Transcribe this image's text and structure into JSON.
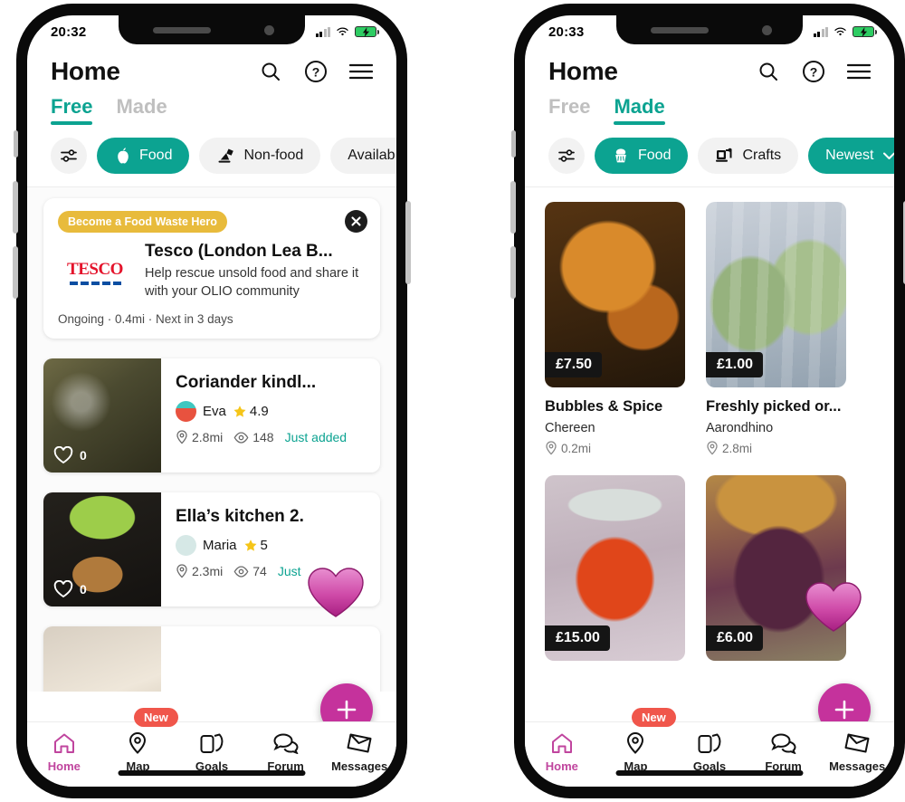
{
  "phones": [
    {
      "id": "left",
      "status": {
        "clock": "20:32",
        "signal_icon": "cellular-signal-icon",
        "wifi_icon": "wifi-icon",
        "battery_icon": "battery-charging-icon"
      },
      "header": {
        "title": "Home",
        "icons": [
          {
            "name": "search-icon",
            "label": "Search"
          },
          {
            "name": "help-icon",
            "label": "Help"
          },
          {
            "name": "menu-icon",
            "label": "Menu"
          }
        ]
      },
      "tabs": [
        {
          "label": "Free",
          "active": true
        },
        {
          "label": "Made",
          "active": false
        }
      ],
      "chips": [
        {
          "name": "filter-settings-chip",
          "label": "",
          "icon": "sliders-icon",
          "active": false,
          "round": true
        },
        {
          "name": "chip-food",
          "label": "Food",
          "icon": "apple-icon",
          "active": true
        },
        {
          "name": "chip-non-food",
          "label": "Non-food",
          "icon": "lamp-icon",
          "active": false
        },
        {
          "name": "chip-availability",
          "label": "Availab",
          "icon": "",
          "active": false
        }
      ],
      "promo": {
        "badge": "Become a Food Waste Hero",
        "brand": "TESCO",
        "title": "Tesco (London Lea B...",
        "description": "Help rescue unsold food and share it with your OLIO community",
        "meta": "Ongoing · 0.4mi · Next in 3 days",
        "close_icon": "close-icon"
      },
      "listings": [
        {
          "title": "Coriander kindl...",
          "user": "Eva",
          "rating": "4.9",
          "distance": "2.8mi",
          "views": "148",
          "status": "Just added",
          "fav_count": "0",
          "image_class": "img-coriander",
          "avatar_color": "#e8523f"
        },
        {
          "title": "Ella’s kitchen 2.",
          "user": "Maria",
          "rating": "5",
          "distance": "2.3mi",
          "views": "74",
          "status": "Just",
          "fav_count": "0",
          "image_class": "img-ella",
          "avatar_color": "#d6e8e6"
        }
      ],
      "nav": {
        "new_badge": "New",
        "items": [
          {
            "label": "Home",
            "icon": "home-icon",
            "active": true
          },
          {
            "label": "Map",
            "icon": "map-pin-icon",
            "active": false
          },
          {
            "label": "Goals",
            "icon": "cards-icon",
            "active": false
          },
          {
            "label": "Forum",
            "icon": "chat-bubbles-icon",
            "active": false
          },
          {
            "label": "Messages",
            "icon": "envelope-icon",
            "active": false
          }
        ]
      },
      "fab": {
        "name": "add-listing-fab",
        "icon": "plus-icon"
      },
      "cursor": {
        "name": "heart-cursor",
        "icon": "heart-icon"
      }
    },
    {
      "id": "right",
      "status": {
        "clock": "20:33",
        "signal_icon": "cellular-signal-icon",
        "wifi_icon": "wifi-icon",
        "battery_icon": "battery-charging-icon"
      },
      "header": {
        "title": "Home",
        "icons": [
          {
            "name": "search-icon",
            "label": "Search"
          },
          {
            "name": "help-icon",
            "label": "Help"
          },
          {
            "name": "menu-icon",
            "label": "Menu"
          }
        ]
      },
      "tabs": [
        {
          "label": "Free",
          "active": false
        },
        {
          "label": "Made",
          "active": true
        }
      ],
      "chips": [
        {
          "name": "filter-settings-chip",
          "label": "",
          "icon": "sliders-icon",
          "active": false,
          "round": true
        },
        {
          "name": "chip-food",
          "label": "Food",
          "icon": "cupcake-icon",
          "active": true
        },
        {
          "name": "chip-crafts",
          "label": "Crafts",
          "icon": "sewing-machine-icon",
          "active": false
        },
        {
          "name": "chip-sort-newest",
          "label": "Newest",
          "icon": "chevron-down-icon",
          "active": true,
          "dropdown": true
        }
      ],
      "grid": [
        {
          "title": "Bubbles & Spice",
          "user": "Chereen",
          "distance": "0.2mi",
          "price": "£7.50",
          "image_class": "img-chicken"
        },
        {
          "title": "Freshly picked or...",
          "user": "Aarondhino",
          "distance": "2.8mi",
          "price": "£1.00",
          "image_class": "img-greens"
        },
        {
          "title": "",
          "user": "",
          "distance": "",
          "price": "£15.00",
          "image_class": "img-kimchi"
        },
        {
          "title": "",
          "user": "",
          "distance": "",
          "price": "£6.00",
          "image_class": "img-seaweed"
        }
      ],
      "nav": {
        "new_badge": "New",
        "items": [
          {
            "label": "Home",
            "icon": "home-icon",
            "active": true
          },
          {
            "label": "Map",
            "icon": "map-pin-icon",
            "active": false
          },
          {
            "label": "Goals",
            "icon": "cards-icon",
            "active": false
          },
          {
            "label": "Forum",
            "icon": "chat-bubbles-icon",
            "active": false
          },
          {
            "label": "Messages",
            "icon": "envelope-icon",
            "active": false
          }
        ]
      },
      "fab": {
        "name": "add-listing-fab",
        "icon": "plus-icon"
      },
      "cursor": {
        "name": "heart-cursor",
        "icon": "heart-icon"
      }
    }
  ],
  "colors": {
    "teal": "#0ca391",
    "magenta": "#c5329c",
    "badge_yellow": "#e8bb3c",
    "badge_red": "#f0564b",
    "nav_active": "#c0459e",
    "tesco_red": "#e4132b",
    "tesco_blue": "#0b4ea2"
  }
}
